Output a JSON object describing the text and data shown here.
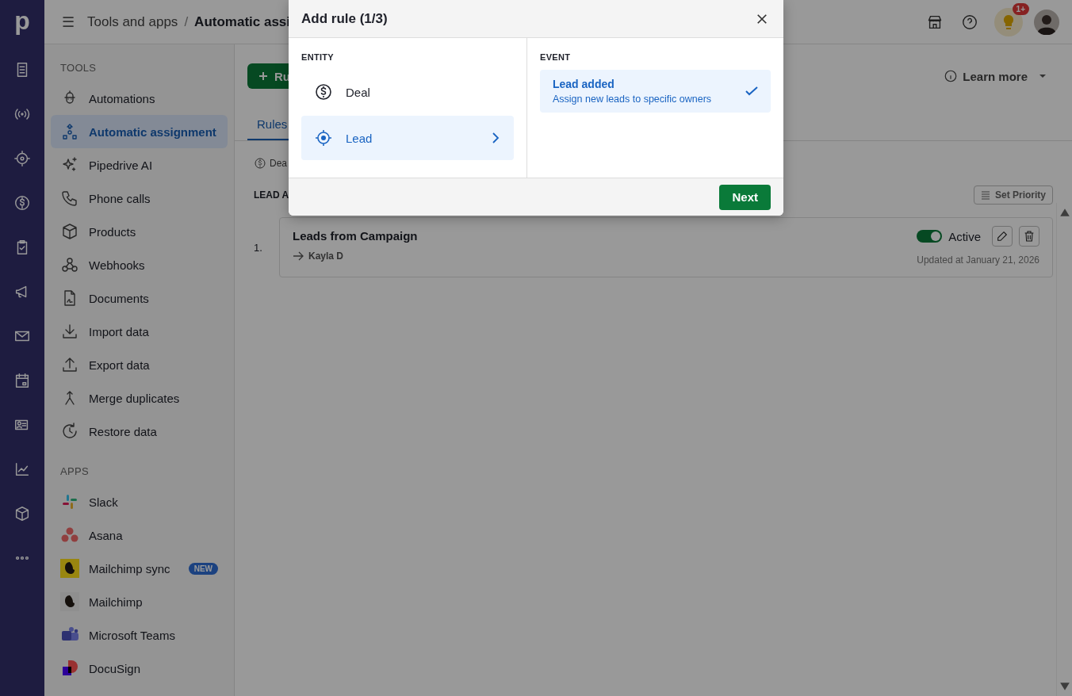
{
  "rail": {
    "logo": "p"
  },
  "topbar": {
    "menu_glyph": "☰",
    "breadcrumb_parent": "Tools and apps",
    "separator": "/",
    "breadcrumb_current": "Automatic assi",
    "notification_badge": "1+"
  },
  "sidebar": {
    "sections": [
      {
        "heading": "TOOLS",
        "items": [
          {
            "label": "Automations",
            "selected": false
          },
          {
            "label": "Automatic assignment",
            "selected": true
          },
          {
            "label": "Pipedrive AI",
            "selected": false
          },
          {
            "label": "Phone calls",
            "selected": false
          },
          {
            "label": "Products",
            "selected": false
          },
          {
            "label": "Webhooks",
            "selected": false
          },
          {
            "label": "Documents",
            "selected": false
          },
          {
            "label": "Import data",
            "selected": false
          },
          {
            "label": "Export data",
            "selected": false
          },
          {
            "label": "Merge duplicates",
            "selected": false
          },
          {
            "label": "Restore data",
            "selected": false
          }
        ]
      },
      {
        "heading": "APPS",
        "items": [
          {
            "label": "Slack",
            "selected": false
          },
          {
            "label": "Asana",
            "selected": false
          },
          {
            "label": "Mailchimp sync",
            "selected": false,
            "badge": "NEW"
          },
          {
            "label": "Mailchimp",
            "selected": false
          },
          {
            "label": "Microsoft Teams",
            "selected": false
          },
          {
            "label": "DocuSign",
            "selected": false
          }
        ]
      }
    ]
  },
  "main": {
    "add_button": "Ru",
    "learn_more": "Learn more",
    "tabs": [
      {
        "label": "Rules",
        "selected": true
      }
    ],
    "filter_chip": "Dea",
    "section_heading": "LEAD A",
    "set_priority": "Set Priority",
    "rules": [
      {
        "number": "1.",
        "title": "Leads from Campaign",
        "owner": "Kayla D",
        "active": true,
        "status": "Active",
        "updated": "Updated at January 21, 2026"
      }
    ]
  },
  "modal": {
    "title": "Add rule (1/3)",
    "entity_heading": "ENTITY",
    "entities": [
      {
        "label": "Deal",
        "selected": false
      },
      {
        "label": "Lead",
        "selected": true
      }
    ],
    "event_heading": "EVENT",
    "events": [
      {
        "title": "Lead added",
        "description": "Assign new leads to specific owners",
        "selected": true
      }
    ],
    "next_button": "Next"
  }
}
